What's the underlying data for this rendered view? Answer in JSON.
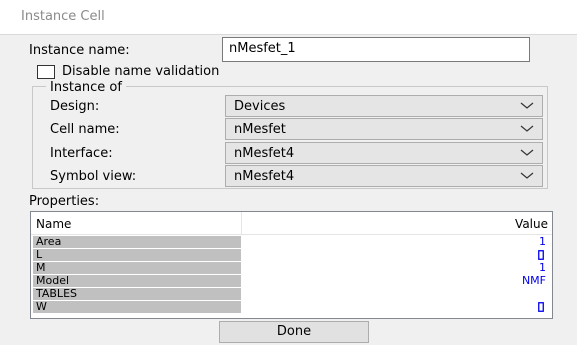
{
  "window": {
    "title": "Instance Cell"
  },
  "instance_name": {
    "label": "Instance name:",
    "value": "nMesfet_1"
  },
  "disable_validation": {
    "label": "Disable name validation",
    "checked": false
  },
  "instance_of": {
    "legend": "Instance of",
    "design": {
      "label": "Design:",
      "value": "Devices"
    },
    "cell_name": {
      "label": "Cell name:",
      "value": "nMesfet"
    },
    "interface": {
      "label": "Interface:",
      "value": "nMesfet4"
    },
    "symbol_view": {
      "label": "Symbol view:",
      "value": "nMesfet4"
    }
  },
  "properties": {
    "label": "Properties:",
    "columns": {
      "name": "Name",
      "value": "Value"
    },
    "rows": [
      {
        "name": "Area",
        "value": "1"
      },
      {
        "name": "L",
        "value": ""
      },
      {
        "name": "M",
        "value": "1"
      },
      {
        "name": "Model",
        "value": "NMF"
      },
      {
        "name": "TABLES",
        "value": ""
      },
      {
        "name": "W",
        "value": ""
      }
    ]
  },
  "buttons": {
    "done": "Done"
  },
  "colors": {
    "link_value": "#0000ee",
    "name_cell_bg": "#c0c0c0"
  },
  "icons": {
    "empty_value": "box-icon",
    "dropdown": "chevron-down-icon"
  }
}
